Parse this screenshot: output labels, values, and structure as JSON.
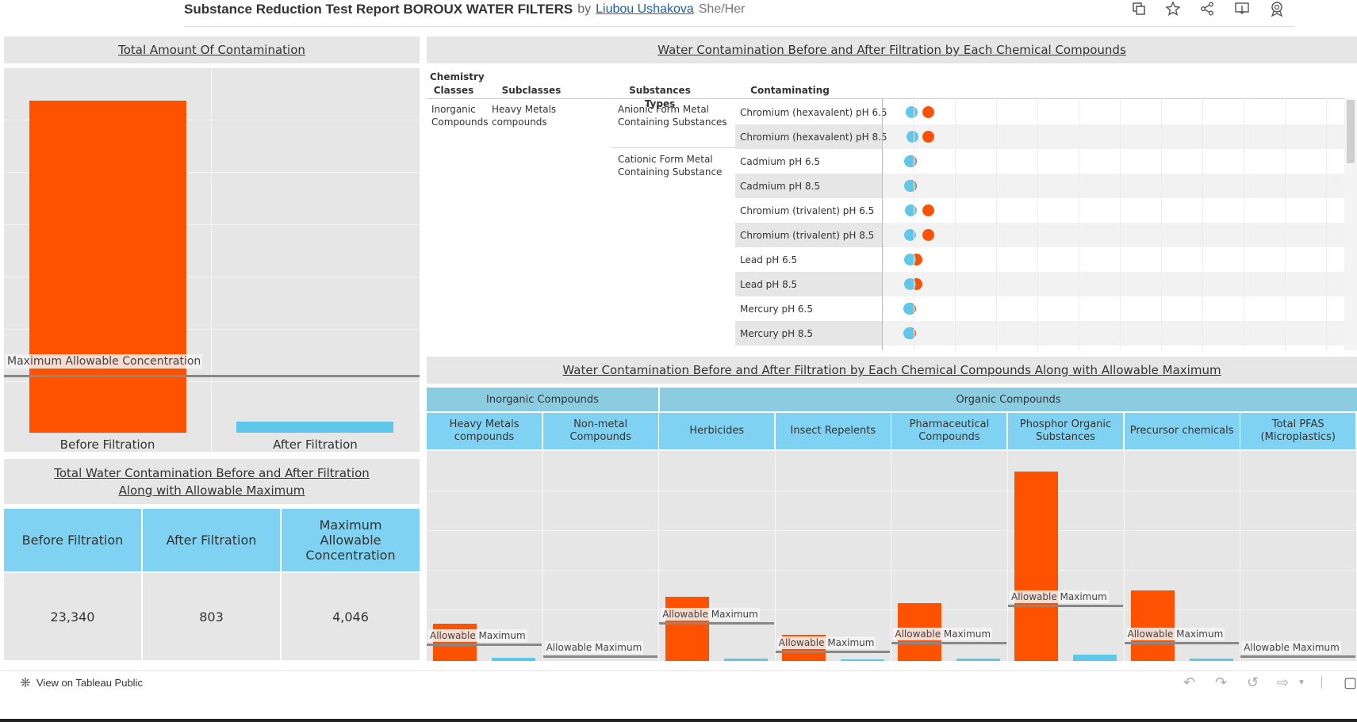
{
  "header": {
    "title": "Substance Reduction Test Report BOROUX WATER FILTERS",
    "by": "by",
    "author": "Liubou Ushakova",
    "pronouns": "She/Her",
    "icons": [
      "duplicate-icon",
      "star-icon",
      "share-icon",
      "download-icon",
      "badge-icon"
    ]
  },
  "panel_total": {
    "title": "Total Amount Of Contamination",
    "ref_label": "Maximum Allowable Concentration",
    "categories": [
      "Before Filtration",
      "After Filtration"
    ]
  },
  "panel_kpi": {
    "title_line1": "Total Water Contamination Before and After Filtration",
    "title_line2": "Along with Allowable Maximum",
    "headers": [
      "Before Filtration",
      "After Filtration",
      "Maximum Allowable Concentration"
    ],
    "values": [
      "23,340",
      "803",
      "4,046"
    ]
  },
  "panel_dots": {
    "title": "Water Contamination Before and After Filtration by Each Chemical Compounds",
    "col_headers": {
      "classes": "Chemistry Classes",
      "subclasses": "Subclasses",
      "types": "Substances Types",
      "substances": "Contaminating Sunstances"
    },
    "class": "Inorganic Compounds",
    "subclass": "Heavy Metals compounds",
    "type_a": "Anionic Form Metal Containing Substances",
    "type_b": "Cationic Form Metal Containing Substance",
    "rows": [
      {
        "name": "Chromium (hexavalent) pH 6.5",
        "after": 0.5,
        "before": 4.0
      },
      {
        "name": "Chromium (hexavalent) pH 8.5",
        "after": 0.6,
        "before": 4.0
      },
      {
        "name": "Cadmium pH 6.5",
        "after": 0.1,
        "before": 0.3
      },
      {
        "name": "Cadmium pH 8.5",
        "after": 0.1,
        "before": 0.3
      },
      {
        "name": "Chromium (trivalent) pH 6.5",
        "after": 0.3,
        "before": 4.0
      },
      {
        "name": "Chromium (trivalent) pH 8.5",
        "after": 0.2,
        "before": 4.0
      },
      {
        "name": "Lead pH 6.5",
        "after": 0.1,
        "before": 1.5
      },
      {
        "name": "Lead pH 8.5",
        "after": 0.1,
        "before": 1.5
      },
      {
        "name": "Mercury pH 6.5",
        "after": 0.05,
        "before": 0.1
      },
      {
        "name": "Mercury pH 8.5",
        "after": 0.05,
        "before": 0.1
      }
    ]
  },
  "panel_bottom": {
    "title": "Water Contamination Before and After Filtration by Each Chemical Compounds Along with Allowable Maximum",
    "groups": [
      "Inorganic Compounds",
      "Organic Compounds"
    ],
    "subclasses": [
      "Heavy Metals compounds",
      "Non-metal Compounds",
      "Herbicides",
      "Insect Repelents",
      "Pharmaceutical Compounds",
      "Phosphor Organic Substances",
      "Precursor chemicals",
      "Total PFAS (Microplastics)"
    ],
    "ref_label": "Allowable Maximum"
  },
  "chart_data": [
    {
      "type": "bar",
      "title": "Total Amount Of Contamination",
      "categories": [
        "Before Filtration",
        "After Filtration"
      ],
      "values": [
        23340,
        803
      ],
      "reference_line": {
        "label": "Maximum Allowable Concentration",
        "value": 4046
      },
      "colors": [
        "#fe5200",
        "#5fc8ea"
      ]
    },
    {
      "type": "scatter",
      "title": "Water Contamination Before and After Filtration by Each Chemical Compounds",
      "categories": [
        "Chromium (hexavalent) pH 6.5",
        "Chromium (hexavalent) pH 8.5",
        "Cadmium pH 6.5",
        "Cadmium pH 8.5",
        "Chromium (trivalent) pH 6.5",
        "Chromium (trivalent) pH 8.5",
        "Lead pH 6.5",
        "Lead pH 8.5",
        "Mercury pH 6.5",
        "Mercury pH 8.5"
      ],
      "series": [
        {
          "values": [
            0.5,
            0.6,
            0.1,
            0.1,
            0.3,
            0.2,
            0.1,
            0.1,
            0.05,
            0.05
          ],
          "color": "#5fc8ea"
        },
        {
          "values": [
            4.0,
            4.0,
            0.3,
            0.3,
            4.0,
            4.0,
            1.5,
            1.5,
            0.1,
            0.1
          ],
          "color": "#fe5200"
        }
      ]
    },
    {
      "type": "bar",
      "title": "Water Contamination Before and After Filtration by Each Chemical Compounds Along with Allowable Maximum",
      "categories": [
        "Heavy Metals compounds",
        "Non-metal Compounds",
        "Herbicides",
        "Insect Repelents",
        "Pharmaceutical Compounds",
        "Phosphor Organic Substances",
        "Precursor chemicals",
        "Total PFAS (Microplastics)"
      ],
      "series": [
        {
          "values": [
            210,
            0,
            365,
            150,
            330,
            1080,
            400,
            0
          ],
          "color": "#fe5200"
        },
        {
          "values": [
            20,
            0,
            15,
            10,
            15,
            35,
            15,
            0
          ],
          "color": "#5fc8ea"
        }
      ],
      "allowable_maximum": [
        100,
        30,
        220,
        60,
        110,
        320,
        110,
        30
      ]
    }
  ],
  "footer": {
    "link": "View on Tableau Public",
    "icons": [
      "undo-icon",
      "redo-icon",
      "revert-icon",
      "refresh-icon",
      "download-icon"
    ]
  }
}
